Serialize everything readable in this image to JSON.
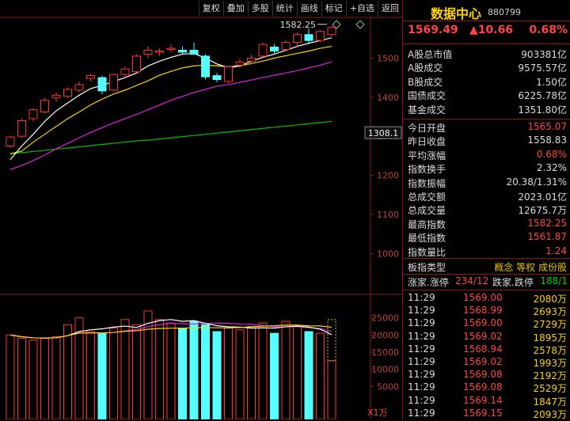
{
  "toolbar": {
    "buttons": [
      "复权",
      "叠加",
      "多股",
      "统计",
      "画线",
      "标记",
      "+自选",
      "返回"
    ]
  },
  "chart": {
    "y_labels": [
      "1500",
      "1400",
      "1300",
      "1200",
      "1100",
      "1000"
    ],
    "current_price_tag": "1308.1",
    "high_annotation": "1582.25",
    "vol_labels": [
      "25000",
      "20000",
      "15000",
      "10000",
      "5000"
    ],
    "vol_unit": "X1万",
    "colors": {
      "up": "#ff3333",
      "down": "#54ffff",
      "ma5": "#ffffff",
      "ma10": "#ffd200",
      "ma20": "#e020e0",
      "ma60": "#00c000"
    }
  },
  "chart_data": {
    "type": "candlestick",
    "ylim": [
      950,
      1600
    ],
    "candles": [
      {
        "o": 1275,
        "h": 1300,
        "l": 1270,
        "c": 1298
      },
      {
        "o": 1300,
        "h": 1345,
        "l": 1295,
        "c": 1340
      },
      {
        "o": 1345,
        "h": 1372,
        "l": 1338,
        "c": 1368
      },
      {
        "o": 1362,
        "h": 1398,
        "l": 1358,
        "c": 1392
      },
      {
        "o": 1398,
        "h": 1412,
        "l": 1388,
        "c": 1405
      },
      {
        "o": 1402,
        "h": 1425,
        "l": 1398,
        "c": 1420
      },
      {
        "o": 1418,
        "h": 1440,
        "l": 1412,
        "c": 1432
      },
      {
        "o": 1448,
        "h": 1460,
        "l": 1440,
        "c": 1455
      },
      {
        "o": 1450,
        "h": 1455,
        "l": 1408,
        "c": 1416
      },
      {
        "o": 1418,
        "h": 1460,
        "l": 1415,
        "c": 1458
      },
      {
        "o": 1458,
        "h": 1478,
        "l": 1452,
        "c": 1472
      },
      {
        "o": 1465,
        "h": 1510,
        "l": 1462,
        "c": 1505
      },
      {
        "o": 1510,
        "h": 1530,
        "l": 1500,
        "c": 1520
      },
      {
        "o": 1515,
        "h": 1525,
        "l": 1505,
        "c": 1518
      },
      {
        "o": 1522,
        "h": 1535,
        "l": 1515,
        "c": 1525
      },
      {
        "o": 1520,
        "h": 1530,
        "l": 1510,
        "c": 1515
      },
      {
        "o": 1520,
        "h": 1540,
        "l": 1508,
        "c": 1510
      },
      {
        "o": 1505,
        "h": 1510,
        "l": 1445,
        "c": 1452
      },
      {
        "o": 1455,
        "h": 1462,
        "l": 1438,
        "c": 1445
      },
      {
        "o": 1440,
        "h": 1480,
        "l": 1435,
        "c": 1478
      },
      {
        "o": 1482,
        "h": 1498,
        "l": 1475,
        "c": 1490
      },
      {
        "o": 1492,
        "h": 1508,
        "l": 1485,
        "c": 1500
      },
      {
        "o": 1505,
        "h": 1540,
        "l": 1502,
        "c": 1535
      },
      {
        "o": 1528,
        "h": 1536,
        "l": 1510,
        "c": 1518
      },
      {
        "o": 1522,
        "h": 1545,
        "l": 1518,
        "c": 1540
      },
      {
        "o": 1540,
        "h": 1565,
        "l": 1530,
        "c": 1560
      },
      {
        "o": 1560,
        "h": 1575,
        "l": 1535,
        "c": 1545
      },
      {
        "o": 1545,
        "h": 1572,
        "l": 1540,
        "c": 1568
      },
      {
        "o": 1560,
        "h": 1582.25,
        "l": 1555,
        "c": 1578
      }
    ],
    "ma5": [
      1240,
      1275,
      1305,
      1338,
      1365,
      1385,
      1405,
      1422,
      1430,
      1440,
      1450,
      1462,
      1480,
      1492,
      1502,
      1510,
      1512,
      1500,
      1485,
      1475,
      1480,
      1492,
      1502,
      1510,
      1520,
      1530,
      1538,
      1545,
      1552
    ],
    "ma10": [
      1255,
      1262,
      1285,
      1305,
      1325,
      1345,
      1362,
      1380,
      1395,
      1408,
      1418,
      1430,
      1442,
      1456,
      1466,
      1475,
      1480,
      1482,
      1480,
      1478,
      1480,
      1486,
      1492,
      1500,
      1506,
      1512,
      1518,
      1525,
      1530
    ],
    "ma20": [
      1215,
      1225,
      1238,
      1252,
      1268,
      1282,
      1296,
      1310,
      1322,
      1334,
      1345,
      1356,
      1368,
      1380,
      1392,
      1402,
      1412,
      1420,
      1428,
      1432,
      1438,
      1444,
      1450,
      1456,
      1462,
      1468,
      1475,
      1482,
      1490
    ],
    "ma60": [
      1255,
      1258,
      1261,
      1264,
      1267,
      1270,
      1273,
      1276,
      1279,
      1282,
      1285,
      1288,
      1290,
      1293,
      1296,
      1299,
      1302,
      1305,
      1308,
      1311,
      1314,
      1317,
      1320,
      1323,
      1326,
      1329,
      1332,
      1335,
      1338
    ],
    "volume": [
      20000,
      19000,
      18500,
      19000,
      19500,
      23000,
      25000,
      21000,
      20500,
      22000,
      24500,
      23000,
      27000,
      24500,
      23500,
      22000,
      24000,
      23000,
      21000,
      22000,
      21500,
      22500,
      23500,
      20500,
      24000,
      22500,
      21000,
      20500,
      12500
    ],
    "vol_ylim": [
      0,
      30000
    ]
  },
  "panel": {
    "title": "数据中心",
    "code": "880799",
    "last": "1569.49",
    "change": "▲10.66",
    "pct": "0.68%",
    "stats_a": [
      {
        "label": "A股总市值",
        "value": "903381亿",
        "color": "white"
      },
      {
        "label": "A股成交",
        "value": "9575.57亿",
        "color": "white"
      },
      {
        "label": "B股成交",
        "value": "1.50亿",
        "color": "white"
      },
      {
        "label": "国债成交",
        "value": "6225.78亿",
        "color": "white"
      },
      {
        "label": "基金成交",
        "value": "1351.80亿",
        "color": "white"
      }
    ],
    "stats_b": [
      {
        "label": "今日开盘",
        "value": "1565.07",
        "color": "red"
      },
      {
        "label": "昨日收盘",
        "value": "1558.83",
        "color": "white"
      },
      {
        "label": "平均涨幅",
        "value": "0.68%",
        "color": "red"
      },
      {
        "label": "指数换手",
        "value": "2.32%",
        "color": "white"
      },
      {
        "label": "指数振幅",
        "value": "20.38/1.31%",
        "color": "white"
      },
      {
        "label": "总成交额",
        "value": "2023.01亿",
        "color": "white"
      },
      {
        "label": "总成交量",
        "value": "12675.7万",
        "color": "white"
      },
      {
        "label": "最高指数",
        "value": "1582.25",
        "color": "red"
      },
      {
        "label": "最低指数",
        "value": "1561.87",
        "color": "red"
      },
      {
        "label": "指数量比",
        "value": "1.24",
        "color": "red"
      }
    ],
    "sector_type_label": "板指类型",
    "sector_type_value": "概念 等权 成份股",
    "rise_label": "涨家.涨停",
    "rise_value": "234/12",
    "fall_label": "跌家.跌停",
    "fall_value": "188/1",
    "ticks": [
      {
        "time": "11:29",
        "price": "1569.00",
        "vol": "2080万"
      },
      {
        "time": "11:29",
        "price": "1568.99",
        "vol": "2693万"
      },
      {
        "time": "11:29",
        "price": "1569.00",
        "vol": "2729万"
      },
      {
        "time": "11:29",
        "price": "1569.02",
        "vol": "1895万"
      },
      {
        "time": "11:29",
        "price": "1568.94",
        "vol": "2578万"
      },
      {
        "time": "11:29",
        "price": "1569.02",
        "vol": "1993万"
      },
      {
        "time": "11:29",
        "price": "1569.08",
        "vol": "2192万"
      },
      {
        "time": "11:29",
        "price": "1569.08",
        "vol": "2529万"
      },
      {
        "time": "11:29",
        "price": "1569.14",
        "vol": "1847万"
      },
      {
        "time": "11:29",
        "price": "1569.15",
        "vol": "2093万"
      }
    ]
  }
}
